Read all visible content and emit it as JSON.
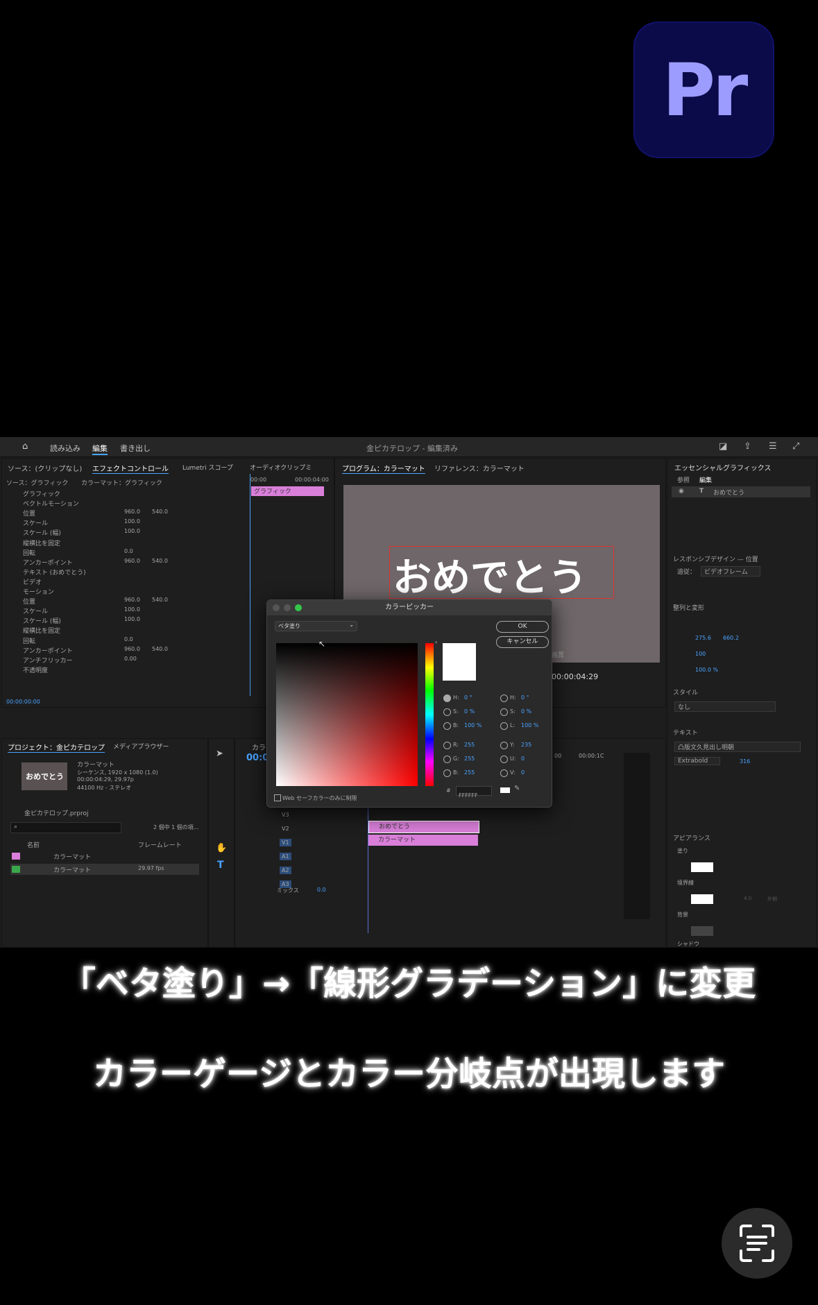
{
  "logo": {
    "text": "Pr"
  },
  "app": {
    "topbar": {
      "import": "読み込み",
      "edit": "編集",
      "export": "書き出し",
      "title": "金ピカテロップ - 編集済み"
    },
    "tabs_left": [
      "ソース：(クリップなし)",
      "エフェクトコントロール",
      "Lumetri スコープ",
      "オーディオクリップミ"
    ],
    "tabs_program": [
      "プログラム：カラーマット",
      "リファレンス：カラーマット"
    ],
    "essential": {
      "title": "エッセンシャルグラフィックス",
      "tab_browse": "参照",
      "tab_edit": "編集",
      "layer": "おめでとう",
      "responsive": "レスポンシブデザイン — 位置",
      "follow_label": "追従：",
      "follow_value": "ビデオフレーム",
      "align": "整列と変形",
      "style": "スタイル",
      "style_value": "なし",
      "text": "テキスト",
      "font": "凸版文久見出し明朝",
      "weight": "Extrabold",
      "size": "316",
      "appearance": "アピアランス",
      "fill": "塗り",
      "stroke": "境界線",
      "background": "背景",
      "shadow": "シャドウ",
      "pos_x": "275.6",
      "pos_y": "660.2",
      "scale": "100",
      "opacity": "100.0 %",
      "stroke_width": "4.0",
      "stroke_type": "外側"
    },
    "effect": {
      "source": "ソース：グラフィック",
      "target": "カラーマット：グラフィック",
      "time_start": "00:00",
      "time_end": "00:00:04:00",
      "clip": "グラフィック",
      "rows": [
        {
          "label": "グラフィック",
          "v1": "",
          "v2": ""
        },
        {
          "label": "ベクトルモーション",
          "v1": "",
          "v2": ""
        },
        {
          "label": "位置",
          "v1": "960.0",
          "v2": "540.0"
        },
        {
          "label": "スケール",
          "v1": "100.0",
          "v2": ""
        },
        {
          "label": "スケール (幅)",
          "v1": "100.0",
          "v2": ""
        },
        {
          "label": "縦横比を固定",
          "v1": "",
          "v2": ""
        },
        {
          "label": "回転",
          "v1": "0.0",
          "v2": ""
        },
        {
          "label": "アンカーポイント",
          "v1": "960.0",
          "v2": "540.0"
        },
        {
          "label": "テキスト (おめでとう)",
          "v1": "",
          "v2": ""
        },
        {
          "label": "ビデオ",
          "v1": "",
          "v2": ""
        },
        {
          "label": "モーション",
          "v1": "",
          "v2": ""
        },
        {
          "label": "位置",
          "v1": "960.0",
          "v2": "540.0"
        },
        {
          "label": "スケール",
          "v1": "100.0",
          "v2": ""
        },
        {
          "label": "スケール (幅)",
          "v1": "100.0",
          "v2": ""
        },
        {
          "label": "縦横比を固定",
          "v1": "",
          "v2": ""
        },
        {
          "label": "回転",
          "v1": "0.0",
          "v2": ""
        },
        {
          "label": "アンカーポイント",
          "v1": "960.0",
          "v2": "540.0"
        },
        {
          "label": "アンチフリッカー",
          "v1": "0.00",
          "v2": ""
        },
        {
          "label": "不透明度",
          "v1": "",
          "v2": ""
        }
      ],
      "timecode": "00:00:00:00"
    },
    "program": {
      "text": "おめでとう",
      "timecode": "00:00:04:29",
      "quality": "画質"
    },
    "project": {
      "tab": "プロジェクト：金ピカテロップ",
      "tab2": "メディアブラウザー",
      "thumb_text": "おめでとう",
      "clip_name": "カラーマット",
      "info1": "シーケンス, 1920 x 1080 (1.0)",
      "info2": "00:00:04:29, 29.97p",
      "info3": "44100 Hz - ステレオ",
      "file": "金ピカテロップ.prproj",
      "count": "2 個中 1 個の項...",
      "col_name": "名前",
      "col_rate": "フレームレート",
      "items": [
        {
          "name": "カラーマット",
          "rate": ""
        },
        {
          "name": "カラーマット",
          "rate": "29.97 fps"
        }
      ]
    },
    "timeline": {
      "tab": "カラ",
      "timecode": "00:0",
      "tracks": [
        "V3",
        "V2",
        "V1",
        "A1",
        "A2",
        "A3"
      ],
      "mix": "ミックス",
      "mix_val": "0.0",
      "clip1": "おめでとう",
      "clip2": "カラーマット",
      "ruler1": "00",
      "ruler2": "00:00:1C"
    }
  },
  "picker": {
    "title": "カラーピッカー",
    "mode": "ベタ塗り",
    "ok": "OK",
    "cancel": "キャンセル",
    "hsb": [
      {
        "k": "H:",
        "v": "0 °"
      },
      {
        "k": "S:",
        "v": "0 %"
      },
      {
        "k": "B:",
        "v": "100 %"
      }
    ],
    "rgb": [
      {
        "k": "R:",
        "v": "255"
      },
      {
        "k": "G:",
        "v": "255"
      },
      {
        "k": "B:",
        "v": "255"
      }
    ],
    "hsl": [
      {
        "k": "H:",
        "v": "0 °"
      },
      {
        "k": "S:",
        "v": "0 %"
      },
      {
        "k": "L:",
        "v": "100 %"
      }
    ],
    "yuv": [
      {
        "k": "Y:",
        "v": "235"
      },
      {
        "k": "U:",
        "v": "0"
      },
      {
        "k": "V:",
        "v": "0"
      }
    ],
    "hex_label": "#",
    "hex": "FFFFFF",
    "websafe": "Web セーフカラーのみに制限"
  },
  "captions": {
    "line1": "「ベタ塗り」→「線形グラデーション」に変更",
    "line2": "カラーゲージとカラー分岐点が出現します"
  },
  "colors": {
    "accent": "#4aa3ff",
    "clip": "#d97fd9",
    "logo_bg": "#0b0b4a",
    "logo_text": "#9c9cff"
  }
}
